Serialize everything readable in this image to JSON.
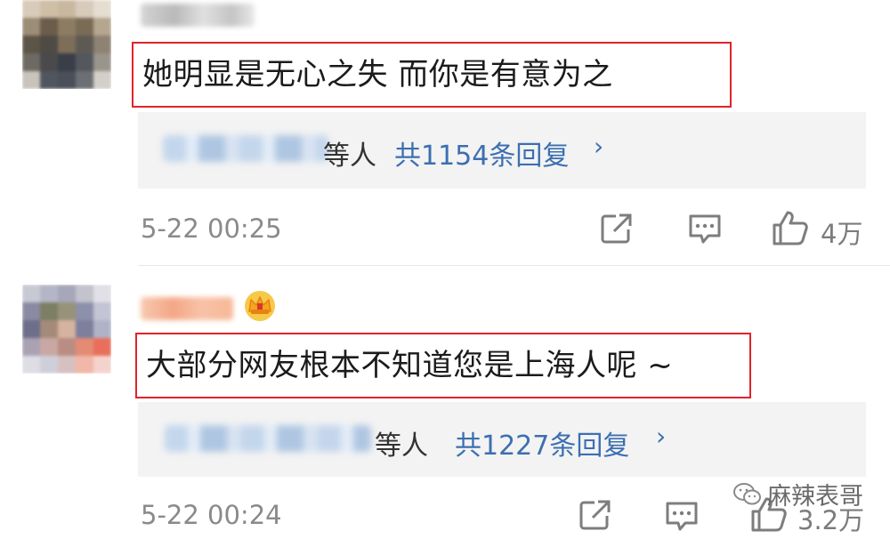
{
  "comments": [
    {
      "text": "她明显是无心之失  而你是有意为之",
      "reply_suffix": "等人",
      "reply_count": "共1154条回复",
      "chevron": "›",
      "time": "5-22 00:25",
      "likes": "4万",
      "has_badge": false
    },
    {
      "text": "大部分网友根本不知道您是上海人呢 ~",
      "reply_suffix": "等人",
      "reply_count": "共1227条回复",
      "chevron": "›",
      "time": "5-22 00:24",
      "likes": "3.2万",
      "has_badge": true,
      "badge_icon": "crown-icon"
    }
  ],
  "icons": {
    "share": "share-icon",
    "comment": "comment-icon",
    "like": "thumbs-up-icon",
    "watermark": "wechat-icon"
  },
  "watermark": {
    "text": "麻辣表哥"
  },
  "colors": {
    "highlight_border": "#e0232c",
    "link_blue": "#3c6fb1",
    "meta_gray": "#8a8a8a",
    "reply_bg": "#f3f3f3"
  }
}
